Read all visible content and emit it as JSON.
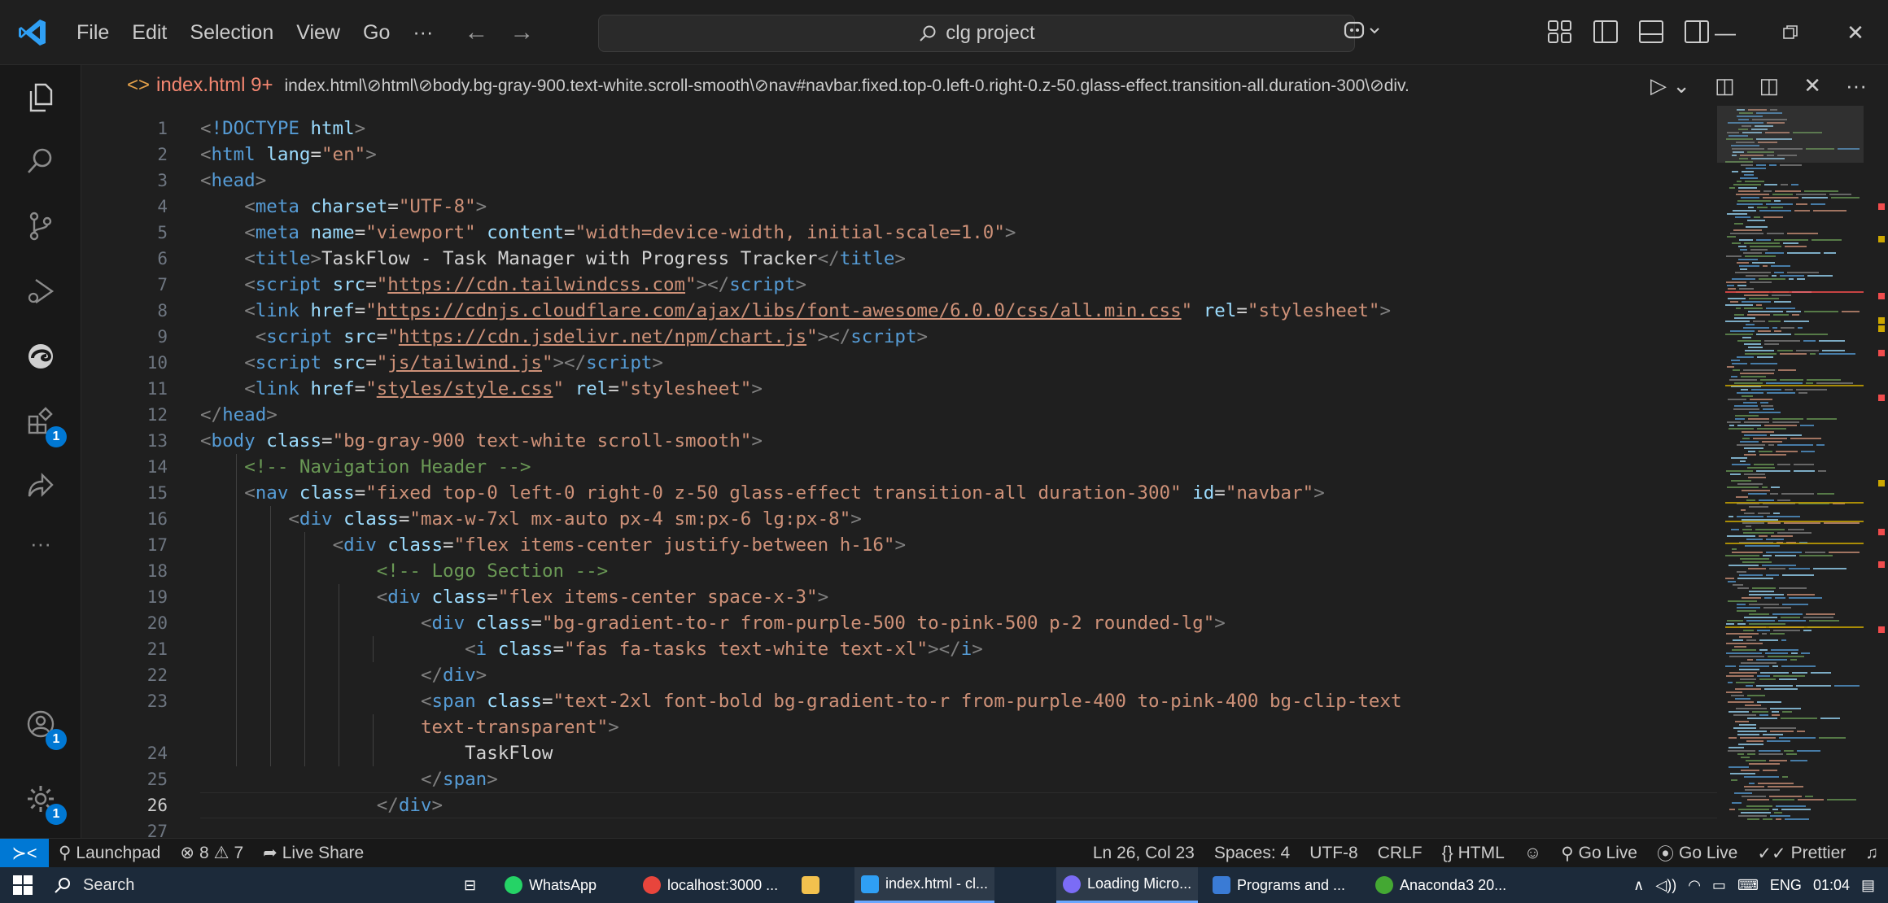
{
  "titlebar": {
    "menu": [
      "File",
      "Edit",
      "Selection",
      "View",
      "Go",
      "···"
    ],
    "search_text": "clg project"
  },
  "activity_bar": {
    "items": [
      {
        "name": "explorer-icon"
      },
      {
        "name": "search-icon"
      },
      {
        "name": "source-control-icon"
      },
      {
        "name": "run-debug-icon"
      },
      {
        "name": "edge-icon"
      },
      {
        "name": "extensions-icon",
        "badge": "1"
      },
      {
        "name": "live-share-icon"
      },
      {
        "name": "more-icon",
        "label": "···"
      }
    ],
    "bottom": [
      {
        "name": "accounts-icon",
        "badge": "1"
      },
      {
        "name": "manage-gear-icon",
        "badge": "1"
      }
    ]
  },
  "editor_tab": {
    "filename": "index.html",
    "problems": "9+",
    "breadcrumb": "index.html\\⊘html\\⊘body.bg-gray-900.text-white.scroll-smooth\\⊘nav#navbar.fixed.top-0.left-0.right-0.z-50.glass-effect.transition-all.duration-300\\⊘div."
  },
  "code_lines": [
    {
      "n": "1",
      "tokens": [
        [
          "punc",
          "<"
        ],
        [
          "doc",
          "!DOCTYPE "
        ],
        [
          "attr",
          "html"
        ],
        [
          "punc",
          ">"
        ]
      ]
    },
    {
      "n": "2",
      "tokens": [
        [
          "punc",
          "<"
        ],
        [
          "tag",
          "html "
        ],
        [
          "attr",
          "lang"
        ],
        [
          "txt",
          "="
        ],
        [
          "str",
          "\"en\""
        ],
        [
          "punc",
          ">"
        ]
      ]
    },
    {
      "n": "3",
      "tokens": [
        [
          "punc",
          "<"
        ],
        [
          "tag",
          "head"
        ],
        [
          "punc",
          ">"
        ]
      ]
    },
    {
      "n": "4",
      "tokens": [
        [
          "txt",
          "    "
        ],
        [
          "punc",
          "<"
        ],
        [
          "tag",
          "meta "
        ],
        [
          "attr",
          "charset"
        ],
        [
          "txt",
          "="
        ],
        [
          "str",
          "\"UTF-8\""
        ],
        [
          "punc",
          ">"
        ]
      ]
    },
    {
      "n": "5",
      "tokens": [
        [
          "txt",
          "    "
        ],
        [
          "punc",
          "<"
        ],
        [
          "tag",
          "meta "
        ],
        [
          "attr",
          "name"
        ],
        [
          "txt",
          "="
        ],
        [
          "str",
          "\"viewport\" "
        ],
        [
          "attr",
          "content"
        ],
        [
          "txt",
          "="
        ],
        [
          "str",
          "\"width=device-width, initial-scale=1.0\""
        ],
        [
          "punc",
          ">"
        ]
      ]
    },
    {
      "n": "6",
      "tokens": [
        [
          "txt",
          "    "
        ],
        [
          "punc",
          "<"
        ],
        [
          "tag",
          "title"
        ],
        [
          "punc",
          ">"
        ],
        [
          "txt",
          "TaskFlow - Task Manager with Progress Tracker"
        ],
        [
          "punc",
          "</"
        ],
        [
          "tag",
          "title"
        ],
        [
          "punc",
          ">"
        ]
      ]
    },
    {
      "n": "7",
      "tokens": [
        [
          "txt",
          "    "
        ],
        [
          "punc",
          "<"
        ],
        [
          "tag",
          "script "
        ],
        [
          "attr",
          "src"
        ],
        [
          "txt",
          "="
        ],
        [
          "str",
          "\""
        ],
        [
          "url",
          "https://cdn.tailwindcss.com"
        ],
        [
          "str",
          "\""
        ],
        [
          "punc",
          "></"
        ],
        [
          "tag",
          "script"
        ],
        [
          "punc",
          ">"
        ]
      ]
    },
    {
      "n": "8",
      "tokens": [
        [
          "txt",
          "    "
        ],
        [
          "punc",
          "<"
        ],
        [
          "tag",
          "link "
        ],
        [
          "attr",
          "href"
        ],
        [
          "txt",
          "="
        ],
        [
          "str",
          "\""
        ],
        [
          "url",
          "https://cdnjs.cloudflare.com/ajax/libs/font-awesome/6.0.0/css/all.min.css"
        ],
        [
          "str",
          "\" "
        ],
        [
          "attr",
          "rel"
        ],
        [
          "txt",
          "="
        ],
        [
          "str",
          "\"stylesheet\""
        ],
        [
          "punc",
          ">"
        ]
      ]
    },
    {
      "n": "9",
      "tokens": [
        [
          "txt",
          "     "
        ],
        [
          "punc",
          "<"
        ],
        [
          "tag",
          "script "
        ],
        [
          "attr",
          "src"
        ],
        [
          "txt",
          "="
        ],
        [
          "str",
          "\""
        ],
        [
          "url",
          "https://cdn.jsdelivr.net/npm/chart.js"
        ],
        [
          "str",
          "\""
        ],
        [
          "punc",
          "></"
        ],
        [
          "tag",
          "script"
        ],
        [
          "punc",
          ">"
        ]
      ]
    },
    {
      "n": "10",
      "tokens": [
        [
          "txt",
          "    "
        ],
        [
          "punc",
          "<"
        ],
        [
          "tag",
          "script "
        ],
        [
          "attr",
          "src"
        ],
        [
          "txt",
          "="
        ],
        [
          "str",
          "\""
        ],
        [
          "url",
          "js/tailwind.js"
        ],
        [
          "str",
          "\""
        ],
        [
          "punc",
          "></"
        ],
        [
          "tag",
          "script"
        ],
        [
          "punc",
          ">"
        ]
      ]
    },
    {
      "n": "11",
      "tokens": [
        [
          "txt",
          "    "
        ],
        [
          "punc",
          "<"
        ],
        [
          "tag",
          "link "
        ],
        [
          "attr",
          "href"
        ],
        [
          "txt",
          "="
        ],
        [
          "str",
          "\""
        ],
        [
          "url",
          "styles/style.css"
        ],
        [
          "str",
          "\" "
        ],
        [
          "attr",
          "rel"
        ],
        [
          "txt",
          "="
        ],
        [
          "str",
          "\"stylesheet\""
        ],
        [
          "punc",
          ">"
        ]
      ]
    },
    {
      "n": "12",
      "tokens": [
        [
          "punc",
          "</"
        ],
        [
          "tag",
          "head"
        ],
        [
          "punc",
          ">"
        ]
      ]
    },
    {
      "n": "13",
      "tokens": [
        [
          "punc",
          "<"
        ],
        [
          "tag",
          "body "
        ],
        [
          "attr",
          "class"
        ],
        [
          "txt",
          "="
        ],
        [
          "str",
          "\"bg-gray-900 text-white scroll-smooth\""
        ],
        [
          "punc",
          ">"
        ]
      ]
    },
    {
      "n": "14",
      "tokens": [
        [
          "txt",
          "    "
        ],
        [
          "com",
          "<!-- Navigation Header -->"
        ]
      ]
    },
    {
      "n": "15",
      "tokens": [
        [
          "txt",
          "    "
        ],
        [
          "punc",
          "<"
        ],
        [
          "tag",
          "nav "
        ],
        [
          "attr",
          "class"
        ],
        [
          "txt",
          "="
        ],
        [
          "str",
          "\"fixed top-0 left-0 right-0 z-50 glass-effect transition-all duration-300\" "
        ],
        [
          "attr",
          "id"
        ],
        [
          "txt",
          "="
        ],
        [
          "str",
          "\"navbar\""
        ],
        [
          "punc",
          ">"
        ]
      ]
    },
    {
      "n": "16",
      "tokens": [
        [
          "txt",
          "        "
        ],
        [
          "punc",
          "<"
        ],
        [
          "tag",
          "div "
        ],
        [
          "attr",
          "class"
        ],
        [
          "txt",
          "="
        ],
        [
          "str",
          "\"max-w-7xl mx-auto px-4 sm:px-6 lg:px-8\""
        ],
        [
          "punc",
          ">"
        ]
      ]
    },
    {
      "n": "17",
      "tokens": [
        [
          "txt",
          "            "
        ],
        [
          "punc",
          "<"
        ],
        [
          "tag",
          "div "
        ],
        [
          "attr",
          "class"
        ],
        [
          "txt",
          "="
        ],
        [
          "str",
          "\"flex items-center justify-between h-16\""
        ],
        [
          "punc",
          ">"
        ]
      ]
    },
    {
      "n": "18",
      "tokens": [
        [
          "txt",
          "                "
        ],
        [
          "com",
          "<!-- Logo Section -->"
        ]
      ]
    },
    {
      "n": "19",
      "tokens": [
        [
          "txt",
          "                "
        ],
        [
          "punc",
          "<"
        ],
        [
          "tag",
          "div "
        ],
        [
          "attr",
          "class"
        ],
        [
          "txt",
          "="
        ],
        [
          "str",
          "\"flex items-center space-x-3\""
        ],
        [
          "punc",
          ">"
        ]
      ]
    },
    {
      "n": "20",
      "tokens": [
        [
          "txt",
          "                    "
        ],
        [
          "punc",
          "<"
        ],
        [
          "tag",
          "div "
        ],
        [
          "attr",
          "class"
        ],
        [
          "txt",
          "="
        ],
        [
          "str",
          "\"bg-gradient-to-r from-purple-500 to-pink-500 p-2 rounded-lg\""
        ],
        [
          "punc",
          ">"
        ]
      ]
    },
    {
      "n": "21",
      "tokens": [
        [
          "txt",
          "                        "
        ],
        [
          "punc",
          "<"
        ],
        [
          "tag",
          "i "
        ],
        [
          "attr",
          "class"
        ],
        [
          "txt",
          "="
        ],
        [
          "str",
          "\"fas fa-tasks text-white text-xl\""
        ],
        [
          "punc",
          "></"
        ],
        [
          "tag",
          "i"
        ],
        [
          "punc",
          ">"
        ]
      ]
    },
    {
      "n": "22",
      "tokens": [
        [
          "txt",
          "                    "
        ],
        [
          "punc",
          "</"
        ],
        [
          "tag",
          "div"
        ],
        [
          "punc",
          ">"
        ]
      ]
    },
    {
      "n": "23",
      "tokens": [
        [
          "txt",
          "                    "
        ],
        [
          "punc",
          "<"
        ],
        [
          "tag",
          "span "
        ],
        [
          "attr",
          "class"
        ],
        [
          "txt",
          "="
        ],
        [
          "str",
          "\"text-2xl font-bold bg-gradient-to-r from-purple-400 to-pink-400 bg-clip-text"
        ]
      ]
    },
    {
      "n": "",
      "tokens": [
        [
          "txt",
          "                    "
        ],
        [
          "str",
          "text-transparent\""
        ],
        [
          "punc",
          ">"
        ]
      ]
    },
    {
      "n": "24",
      "tokens": [
        [
          "txt",
          "                        TaskFlow"
        ]
      ]
    },
    {
      "n": "25",
      "tokens": [
        [
          "txt",
          "                    "
        ],
        [
          "punc",
          "</"
        ],
        [
          "tag",
          "span"
        ],
        [
          "punc",
          ">"
        ]
      ]
    },
    {
      "n": "26",
      "current": true,
      "tokens": [
        [
          "txt",
          "                "
        ],
        [
          "punc",
          "</"
        ],
        [
          "tag",
          "div"
        ],
        [
          "punc",
          ">"
        ]
      ]
    },
    {
      "n": "27",
      "tokens": []
    }
  ],
  "statusbar": {
    "launchpad": "Launchpad",
    "errors": "8",
    "warnings": "7",
    "live_share": "Live Share",
    "position": "Ln 26, Col 23",
    "spaces": "Spaces: 4",
    "encoding": "UTF-8",
    "eol": "CRLF",
    "language": "HTML",
    "go_live_1": "Go Live",
    "go_live_2": "Go Live",
    "prettier": "Prettier"
  },
  "taskbar": {
    "search": "Search",
    "apps": [
      {
        "label": "WhatsApp"
      },
      {
        "label": "localhost:3000 ..."
      },
      {
        "label": "index.html - cl..."
      },
      {
        "label": "Loading Micro..."
      },
      {
        "label": "Programs and ..."
      },
      {
        "label": "Anaconda3 20..."
      }
    ],
    "language": "ENG",
    "time": "01:04"
  }
}
